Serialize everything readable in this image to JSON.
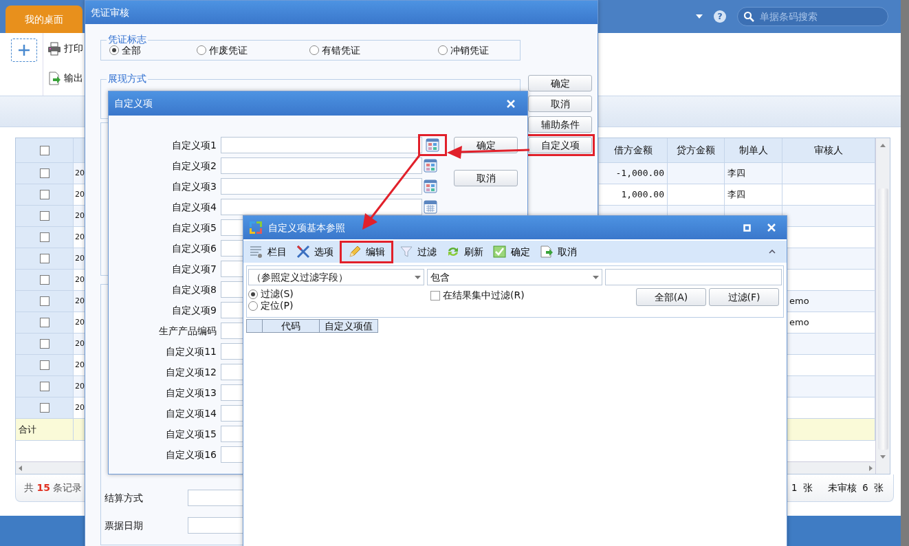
{
  "app": {
    "tab": "我的桌面",
    "help_label": "?",
    "search_placeholder": "单据条码搜索",
    "toolbar": [
      {
        "label": "打印",
        "kind": "print"
      },
      {
        "label": "输出",
        "kind": "export"
      }
    ]
  },
  "grid": {
    "select_all_checked": false,
    "columns": [
      "借方金额",
      "贷方金额",
      "制单人",
      "审核人"
    ],
    "rows": [
      {
        "checked": false,
        "column_2": "20",
        "debit": "-1,000.00",
        "maker": "李四"
      },
      {
        "checked": false,
        "column_2": "20",
        "debit": "1,000.00",
        "maker": "李四"
      },
      {
        "checked": false,
        "column_2": "20"
      },
      {
        "checked": false,
        "column_2": "20"
      },
      {
        "checked": false,
        "column_2": "20"
      },
      {
        "checked": false,
        "column_2": "20"
      },
      {
        "checked": false,
        "column_2": "20",
        "reviewer": "emo"
      },
      {
        "checked": false,
        "column_2": "20",
        "reviewer": "emo"
      },
      {
        "checked": false,
        "column_2": "20"
      },
      {
        "checked": false,
        "column_2": "20"
      },
      {
        "checked": false,
        "column_2": "20"
      },
      {
        "checked": false,
        "column_2": "20"
      }
    ],
    "total_label": "合计"
  },
  "status_bar": {
    "count_before": "共",
    "count": "15",
    "count_after": "条记录",
    "audited": "1 张",
    "unaudited": "未审核 6 张"
  },
  "voucher_window": {
    "title": "凭证审核",
    "mark_group": {
      "legend": "凭证标志",
      "options": [
        {
          "label": "全部",
          "selected": true
        },
        {
          "label": "作废凭证",
          "selected": false
        },
        {
          "label": "有错凭证",
          "selected": false
        },
        {
          "label": "冲销凭证",
          "selected": false
        }
      ]
    },
    "display_group": {
      "legend": "展现方式"
    },
    "buttons": [
      {
        "label": "确定",
        "highlighted": false
      },
      {
        "label": "取消",
        "highlighted": false
      },
      {
        "label": "辅助条件",
        "highlighted": false
      },
      {
        "label": "自定义项",
        "highlighted": true
      }
    ],
    "fields": [
      {
        "label": "结算方式"
      },
      {
        "label": "票据日期"
      }
    ]
  },
  "custom_dialog": {
    "title": "自定义项",
    "items": [
      {
        "label": "自定义项1",
        "kind": "reference",
        "highlighted": true
      },
      {
        "label": "自定义项2",
        "kind": "reference",
        "highlighted": false
      },
      {
        "label": "自定义项3",
        "kind": "reference",
        "highlighted": false
      },
      {
        "label": "自定义项4",
        "kind": "calendar",
        "highlighted": false
      },
      {
        "label": "自定义项5"
      },
      {
        "label": "自定义项6"
      },
      {
        "label": "自定义项7"
      },
      {
        "label": "自定义项8"
      },
      {
        "label": "自定义项9"
      },
      {
        "label": "生产产品编码"
      },
      {
        "label": "自定义项11"
      },
      {
        "label": "自定义项12"
      },
      {
        "label": "自定义项13"
      },
      {
        "label": "自定义项14"
      },
      {
        "label": "自定义项15"
      },
      {
        "label": "自定义项16"
      }
    ],
    "buttons": [
      "确定",
      "取消"
    ]
  },
  "reference_dialog": {
    "title": "自定义项基本参照",
    "toolbar": [
      {
        "label": "栏目",
        "kind": "columns",
        "highlighted": false
      },
      {
        "label": "选项",
        "kind": "tools",
        "highlighted": false
      },
      {
        "label": "编辑",
        "kind": "pencil",
        "highlighted": true
      },
      {
        "label": "过滤",
        "kind": "funnel",
        "highlighted": false
      },
      {
        "label": "刷新",
        "kind": "refresh",
        "highlighted": false
      },
      {
        "label": "确定",
        "kind": "check",
        "highlighted": false
      },
      {
        "label": "取消",
        "kind": "exit",
        "highlighted": false
      }
    ],
    "filter": {
      "field": "（参照定义过滤字段）",
      "operator": "包含",
      "modes": [
        {
          "label": "过滤(S)",
          "selected": true
        },
        {
          "label": "定位(P)",
          "selected": false
        }
      ],
      "in_results": {
        "label": "在结果集中过滤(R)",
        "checked": false
      },
      "buttons": [
        "全部(A)",
        "过滤(F)"
      ]
    },
    "columns": [
      "代码",
      "自定义项值"
    ]
  }
}
